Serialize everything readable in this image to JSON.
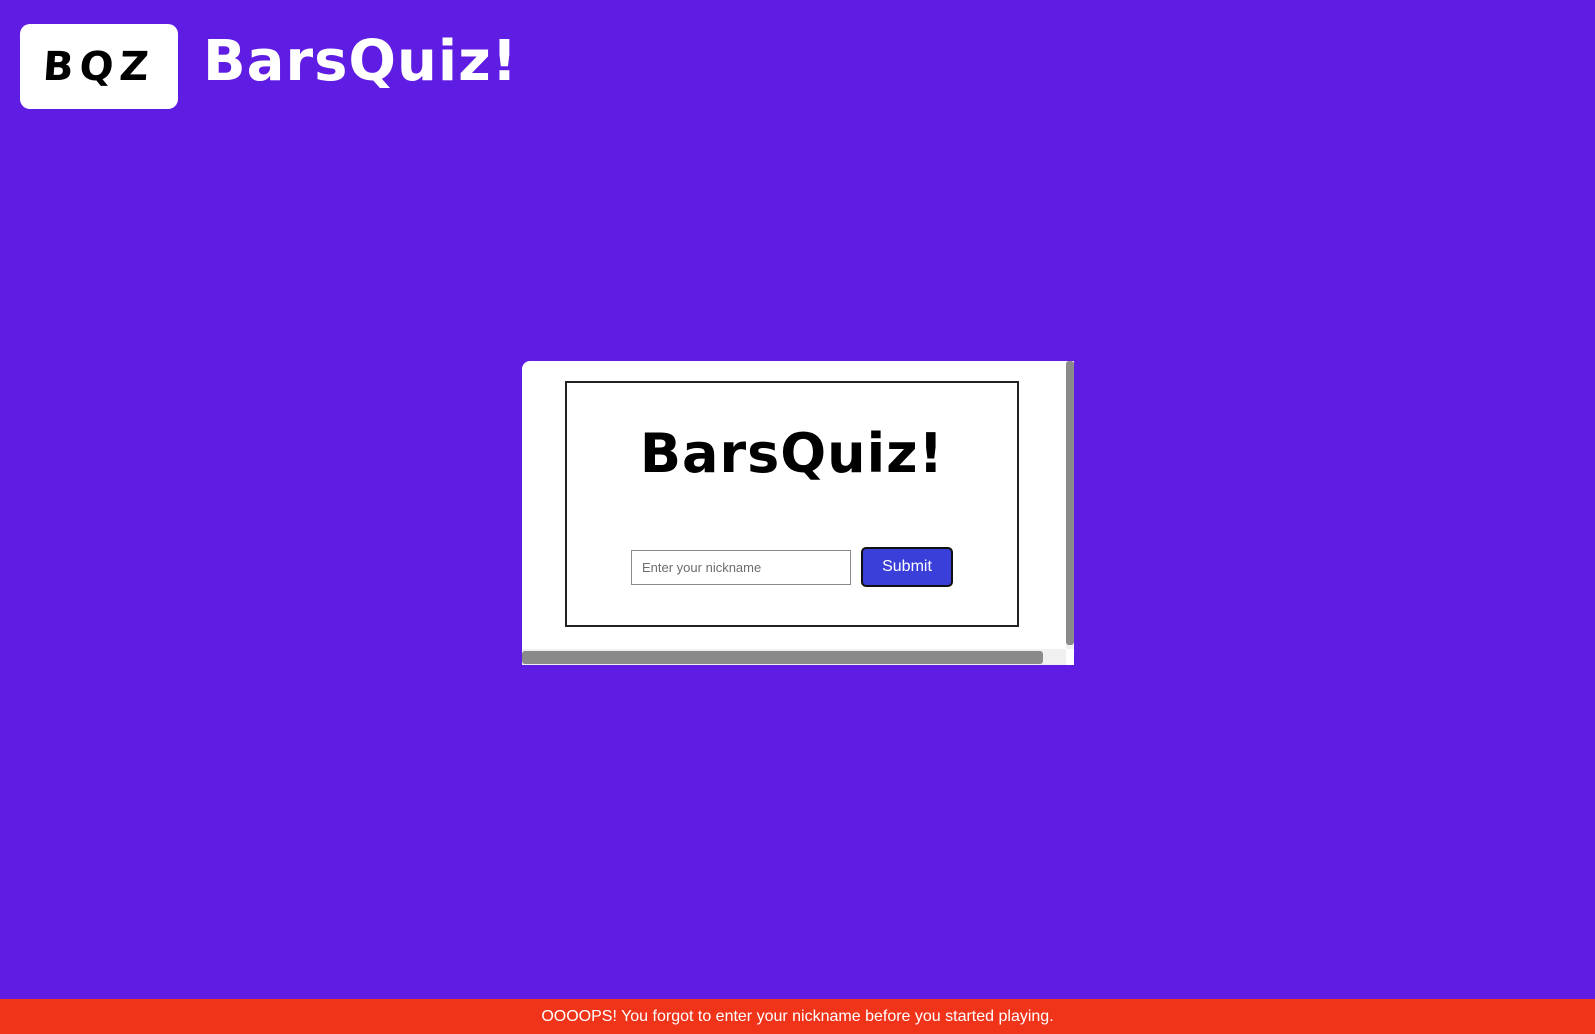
{
  "header": {
    "logo_text": "BQZ",
    "brand_title": "BarsQuiz!"
  },
  "card": {
    "title": "BarsQuiz!",
    "nickname_input": {
      "value": "",
      "placeholder": "Enter your nickname"
    },
    "submit_label": "Submit"
  },
  "error_bar": {
    "message": "OOOOPS! You forgot to enter your nickname before you started playing."
  },
  "colors": {
    "background": "#5f1ce3",
    "submit_button": "#3a3fd9",
    "error_bar": "#ef3419"
  }
}
